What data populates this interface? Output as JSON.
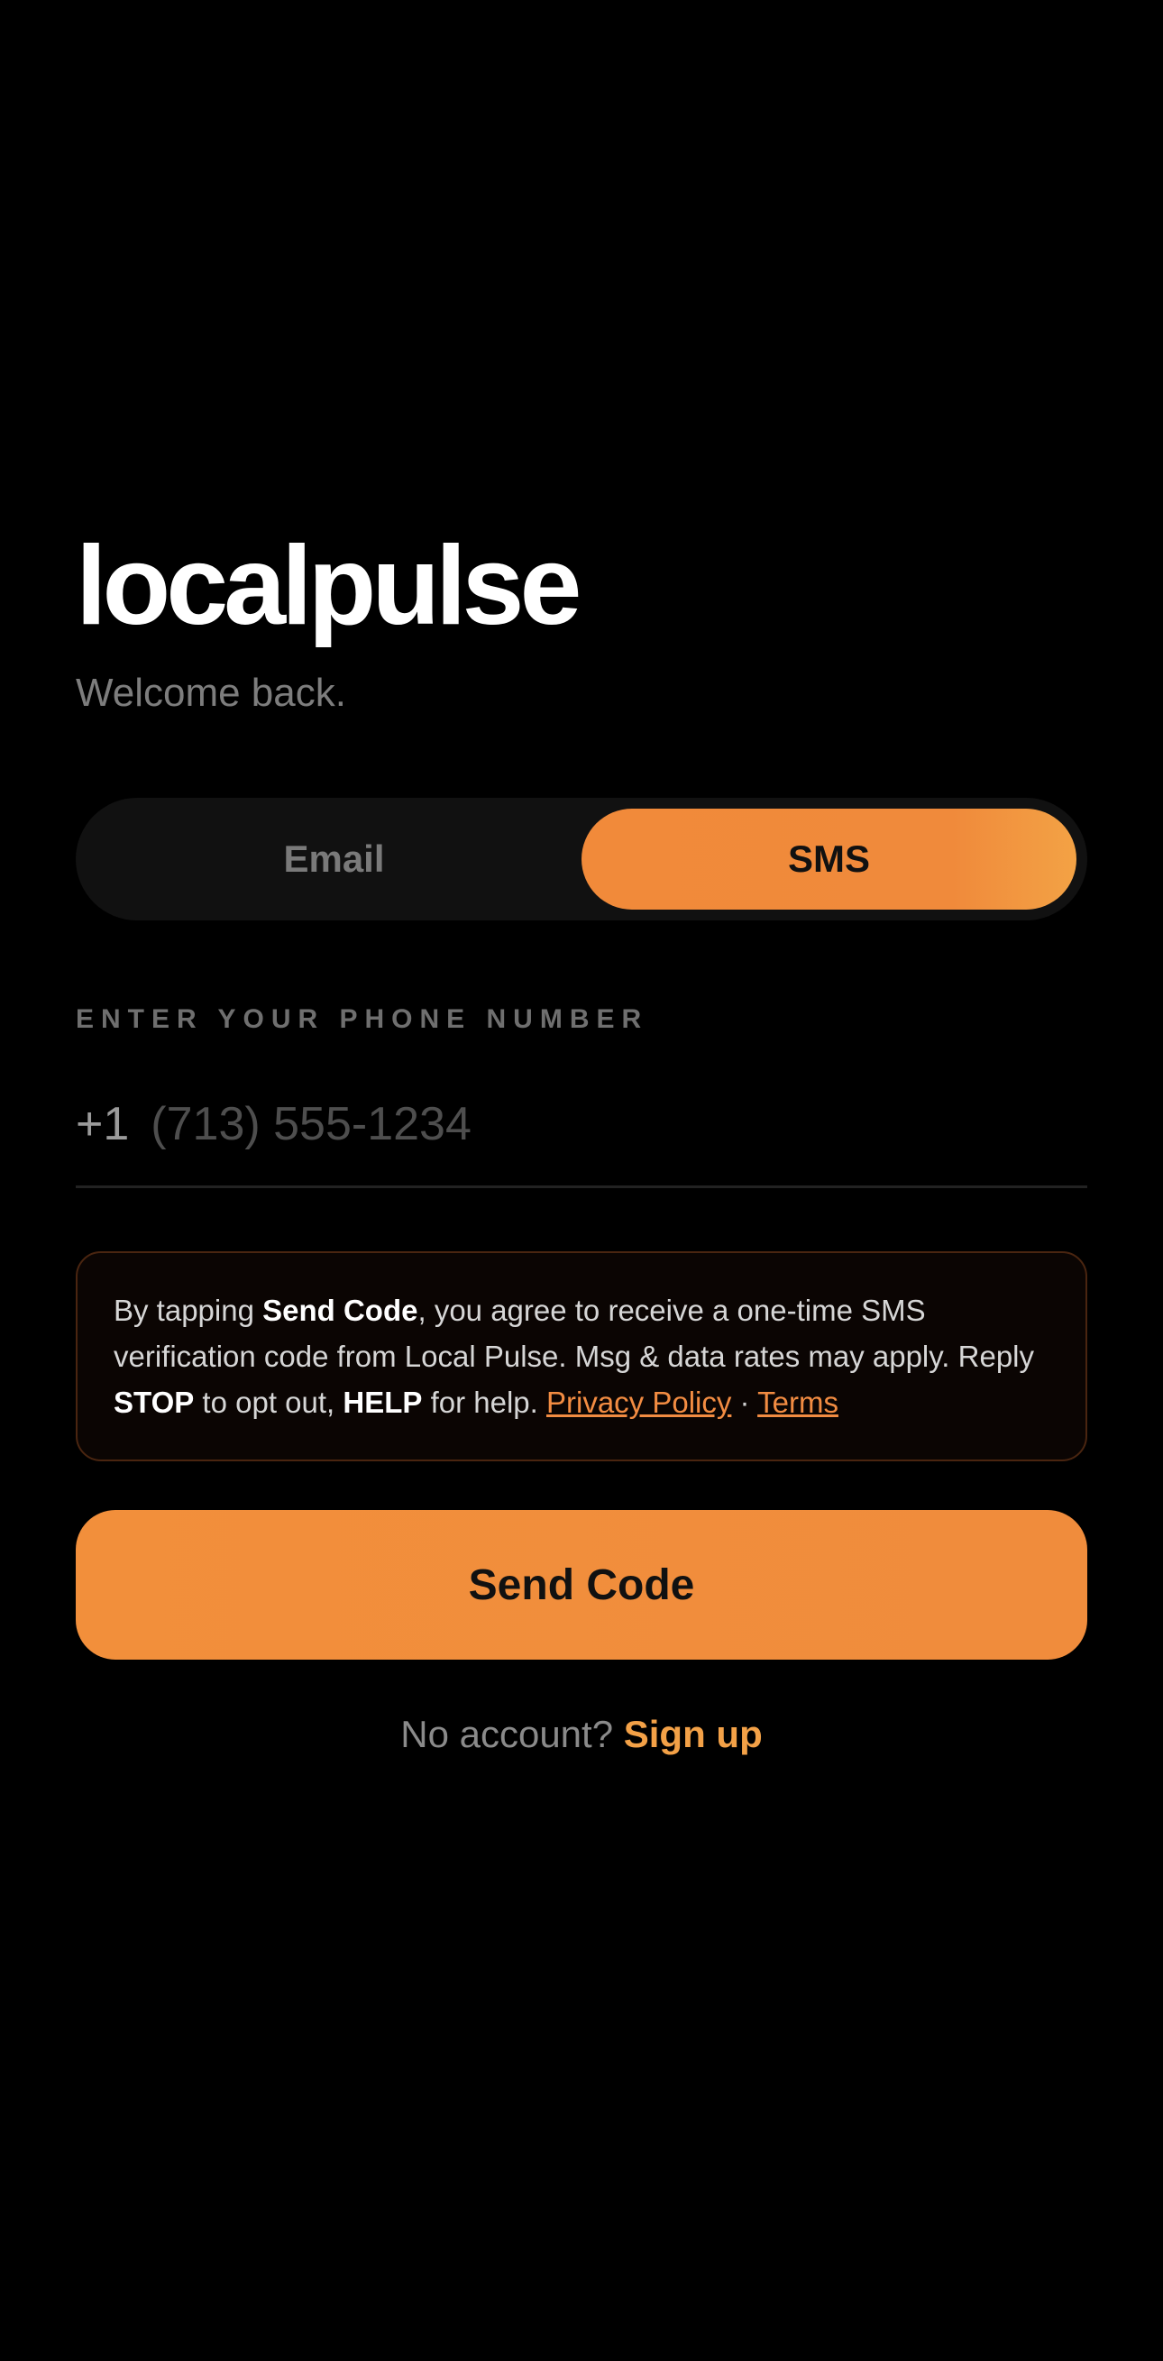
{
  "brand": {
    "name": "localpulse",
    "subtitle": "Welcome back."
  },
  "auth_mode": {
    "options": [
      {
        "label": "Email",
        "active": false
      },
      {
        "label": "SMS",
        "active": true
      }
    ]
  },
  "phone": {
    "label": "ENTER YOUR PHONE NUMBER",
    "country_code": "+1",
    "placeholder": "(713) 555-1234",
    "value": ""
  },
  "consent": {
    "text_1": "By tapping ",
    "bold_1": "Send Code",
    "text_2": ", you agree to receive a one-time SMS verification code from Local Pulse. Msg & data rates may apply. Reply ",
    "bold_2": "STOP",
    "text_3": " to opt out, ",
    "bold_3": "HELP",
    "text_4": " for help. ",
    "privacy_link": "Privacy Policy",
    "separator": " · ",
    "terms_link": "Terms"
  },
  "actions": {
    "send_code": "Send Code"
  },
  "signup": {
    "prefix": "No account?",
    "link": "Sign up"
  },
  "colors": {
    "accent": "#F08A3B",
    "background": "#000000"
  }
}
